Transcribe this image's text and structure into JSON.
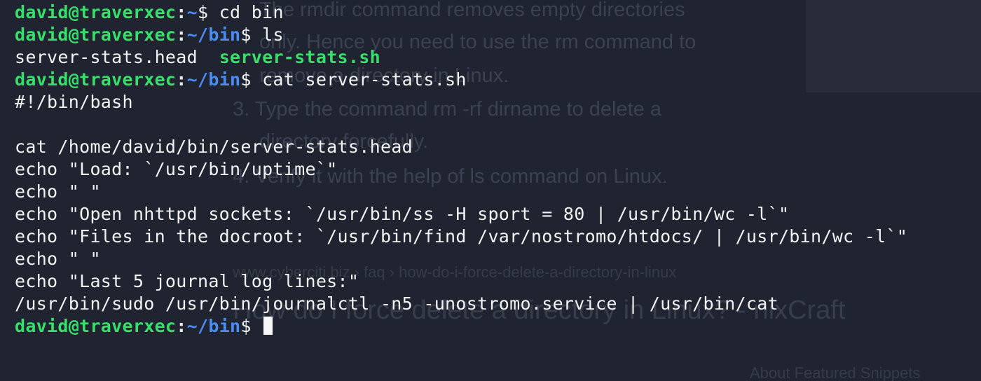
{
  "background_page": {
    "lines": [
      "The rmdir command removes empty directories",
      "only. Hence you need to use the rm command to",
      "remove a directory in Linux.",
      "3. Type the command rm -rf dirname to delete a",
      "directory forcefully.",
      "4. Verify it with the help of ls command on Linux.",
      "www.cyberciti.biz › faq › how-do-i-force-delete-a-directory-in-linux",
      "How do I force delete a directory in Linux? - nixCraft",
      "About Featured Snippets"
    ]
  },
  "terminal": {
    "prompt": {
      "user_host": "david@traverxec",
      "colon": ":",
      "dollar": "$ "
    },
    "lines": [
      {
        "kind": "prompt",
        "path": "~",
        "command": "cd bin"
      },
      {
        "kind": "prompt",
        "path": "~/bin",
        "command": "ls"
      },
      {
        "kind": "ls",
        "files": [
          "server-stats.head",
          "server-stats.sh"
        ]
      },
      {
        "kind": "prompt",
        "path": "~/bin",
        "command": "cat server-stats.sh"
      },
      {
        "kind": "out",
        "text": "#!/bin/bash"
      },
      {
        "kind": "out",
        "text": ""
      },
      {
        "kind": "out",
        "text": "cat /home/david/bin/server-stats.head"
      },
      {
        "kind": "out",
        "text": "echo \"Load: `/usr/bin/uptime`\""
      },
      {
        "kind": "out",
        "text": "echo \" \""
      },
      {
        "kind": "out",
        "text": "echo \"Open nhttpd sockets: `/usr/bin/ss -H sport = 80 | /usr/bin/wc -l`\""
      },
      {
        "kind": "out",
        "text": "echo \"Files in the docroot: `/usr/bin/find /var/nostromo/htdocs/ | /usr/bin/wc -l`\""
      },
      {
        "kind": "out",
        "text": "echo \" \""
      },
      {
        "kind": "out",
        "text": "echo \"Last 5 journal log lines:\""
      },
      {
        "kind": "out",
        "text": "/usr/bin/sudo /usr/bin/journalctl -n5 -unostromo.service | /usr/bin/cat"
      },
      {
        "kind": "prompt",
        "path": "~/bin",
        "command": ""
      }
    ]
  },
  "colors": {
    "background": "#1f2430",
    "prompt_user": "#37e06b",
    "prompt_path": "#4a8df8",
    "executable": "#37e06b",
    "text": "#f2f2f2"
  }
}
